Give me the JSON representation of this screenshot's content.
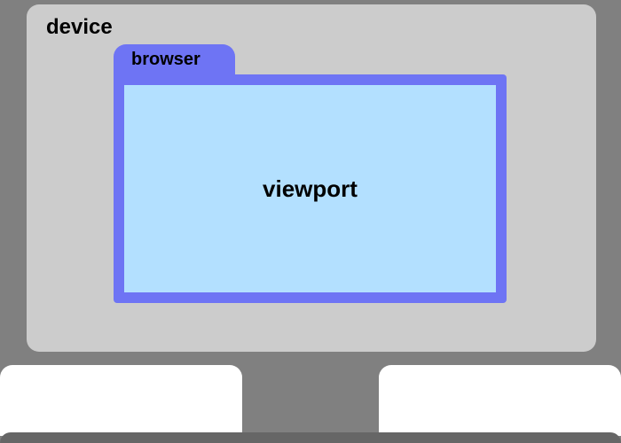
{
  "labels": {
    "device": "device",
    "browser": "browser",
    "viewport": "viewport"
  },
  "colors": {
    "background": "#808080",
    "device": "#cccccc",
    "browser": "#6e74f4",
    "viewport": "#b3e0ff",
    "panel": "#ffffff",
    "bottom_bar": "#666666"
  }
}
